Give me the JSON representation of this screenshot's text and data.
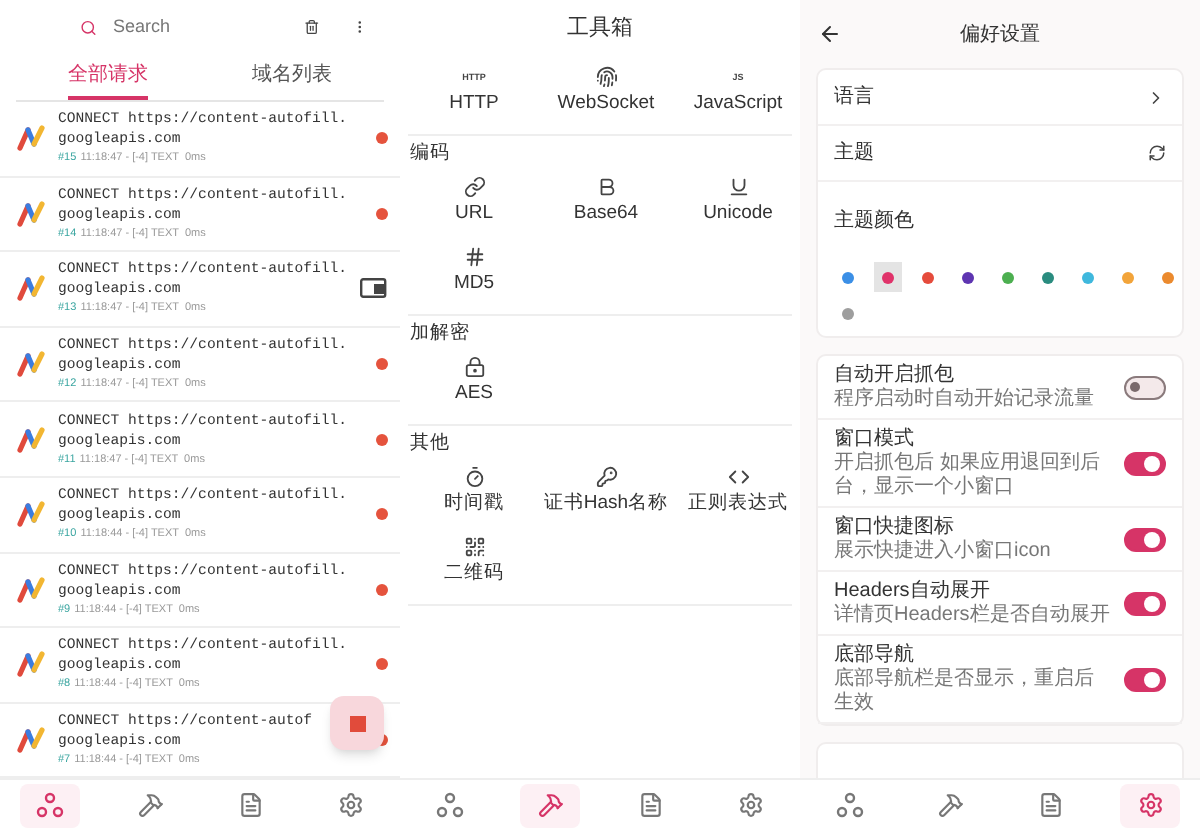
{
  "requests_panel": {
    "search": {
      "placeholder": "Search"
    },
    "tabs": [
      {
        "label": "全部请求",
        "selected": true
      },
      {
        "label": "域名列表",
        "selected": false
      }
    ],
    "rows": [
      {
        "line1": "CONNECT https://content-autofill.",
        "line2": "googleapis.com",
        "id": "#15",
        "meta": "11:18:47 - [-4] TEXT  0ms",
        "window_badge": false
      },
      {
        "line1": "CONNECT https://content-autofill.",
        "line2": "googleapis.com",
        "id": "#14",
        "meta": "11:18:47 - [-4] TEXT  0ms",
        "window_badge": false
      },
      {
        "line1": "CONNECT https://content-autofill.",
        "line2": "googleapis.com",
        "id": "#13",
        "meta": "11:18:47 - [-4] TEXT  0ms",
        "window_badge": true
      },
      {
        "line1": "CONNECT https://content-autofill.",
        "line2": "googleapis.com",
        "id": "#12",
        "meta": "11:18:47 - [-4] TEXT  0ms",
        "window_badge": false
      },
      {
        "line1": "CONNECT https://content-autofill.",
        "line2": "googleapis.com",
        "id": "#11",
        "meta": "11:18:47 - [-4] TEXT  0ms",
        "window_badge": false
      },
      {
        "line1": "CONNECT https://content-autofill.",
        "line2": "googleapis.com",
        "id": "#10",
        "meta": "11:18:44 - [-4] TEXT  0ms",
        "window_badge": false
      },
      {
        "line1": "CONNECT https://content-autofill.",
        "line2": "googleapis.com",
        "id": "#9",
        "meta": "11:18:44 - [-4] TEXT  0ms",
        "window_badge": false
      },
      {
        "line1": "CONNECT https://content-autofill.",
        "line2": "googleapis.com",
        "id": "#8",
        "meta": "11:18:44 - [-4] TEXT  0ms",
        "window_badge": false
      },
      {
        "line1": "CONNECT https://content-autof",
        "line2": "googleapis.com",
        "id": "#7",
        "meta": "11:18:44 - [-4] TEXT  0ms",
        "window_badge": false
      }
    ],
    "nav": [
      {
        "selected": true
      },
      {
        "selected": false
      },
      {
        "selected": false
      },
      {
        "selected": false
      }
    ]
  },
  "toolbox_panel": {
    "title": "工具箱",
    "sections": [
      {
        "tools": [
          {
            "kind": "glyph",
            "glyph": "HTTP",
            "label": "HTTP"
          },
          {
            "kind": "fingerprint",
            "label": "WebSocket"
          },
          {
            "kind": "glyph",
            "glyph": "JS",
            "label": "JavaScript"
          }
        ]
      },
      {
        "heading": "编码",
        "tools": [
          {
            "kind": "link",
            "label": "URL"
          },
          {
            "kind": "bold",
            "label": "Base64"
          },
          {
            "kind": "underline",
            "label": "Unicode"
          },
          {
            "kind": "hash",
            "label": "MD5"
          }
        ]
      },
      {
        "heading": "加解密",
        "tools": [
          {
            "kind": "lock",
            "label": "AES"
          }
        ]
      },
      {
        "heading": "其他",
        "tools": [
          {
            "kind": "timer",
            "label": "时间戳"
          },
          {
            "kind": "key",
            "label": "证书Hash名称"
          },
          {
            "kind": "code",
            "label": "正则表达式"
          },
          {
            "kind": "qr",
            "label": "二维码"
          }
        ]
      }
    ],
    "nav": [
      {
        "selected": false
      },
      {
        "selected": true
      },
      {
        "selected": false
      },
      {
        "selected": false
      }
    ]
  },
  "settings_panel": {
    "title": "偏好设置",
    "rows": [
      {
        "kind": "link",
        "label": "语言"
      },
      {
        "kind": "cycle",
        "label": "主题"
      },
      {
        "kind": "palette",
        "label": "主题颜色",
        "swatches": [
          {
            "color": "#3b8fe6",
            "selected": false
          },
          {
            "color": "#e0336a",
            "selected": true
          },
          {
            "color": "#e54b3c",
            "selected": false
          },
          {
            "color": "#5e35b1",
            "selected": false
          },
          {
            "color": "#4caf50",
            "selected": false
          },
          {
            "color": "#2a8c7f",
            "selected": false
          },
          {
            "color": "#3fb8dd",
            "selected": false
          },
          {
            "color": "#f2a43a",
            "selected": false
          },
          {
            "color": "#eb8a2e",
            "selected": false
          },
          {
            "color": "#9e9e9e",
            "selected": false
          }
        ]
      }
    ],
    "toggles": [
      {
        "title": "自动开启抓包",
        "subtitle": "程序启动时自动开始记录流量",
        "on": false
      },
      {
        "title": "窗口模式",
        "subtitle": "开启抓包后 如果应用退回到后台，显示一个小窗口",
        "on": true
      },
      {
        "title": "窗口快捷图标",
        "subtitle": "展示快捷进入小窗口icon",
        "on": true
      },
      {
        "title": "Headers自动展开",
        "subtitle": "详情页Headers栏是否自动展开",
        "on": true
      },
      {
        "title": "底部导航",
        "subtitle": "底部导航栏是否显示，重启后生效",
        "on": true
      }
    ],
    "nav": [
      {
        "selected": false
      },
      {
        "selected": false
      },
      {
        "selected": false
      },
      {
        "selected": true
      }
    ]
  }
}
